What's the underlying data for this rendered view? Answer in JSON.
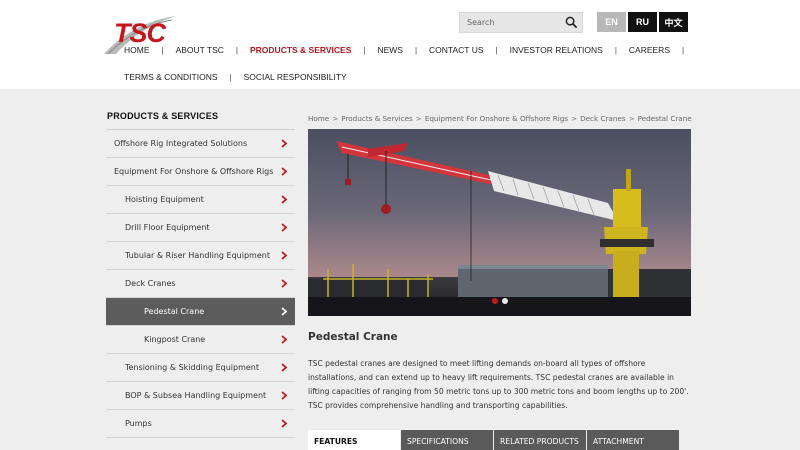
{
  "brand": {
    "logo_text": "TSC"
  },
  "search": {
    "placeholder": "Search"
  },
  "languages": [
    "EN",
    "RU",
    "中文"
  ],
  "nav": {
    "row1": [
      "HOME",
      "ABOUT TSC",
      "PRODUCTS & SERVICES",
      "NEWS",
      "CONTACT US",
      "INVESTOR RELATIONS",
      "CAREERS"
    ],
    "row2": [
      "TERMS & CONDITIONS",
      "SOCIAL RESPONSIBILITY"
    ]
  },
  "sidebar": {
    "title": "PRODUCTS & SERVICES",
    "items": [
      {
        "label": "Offshore Rig Integrated Solutions"
      },
      {
        "label": "Equipment For Onshore & Offshore Rigs"
      },
      {
        "label": "Hoisting Equipment"
      },
      {
        "label": "Drill Floor Equipment"
      },
      {
        "label": "Tubular & Riser Handling Equipment"
      },
      {
        "label": "Deck Cranes"
      },
      {
        "label": "Pedestal Crane"
      },
      {
        "label": "Kingpost Crane"
      },
      {
        "label": "Tensioning & Skidding Equipment"
      },
      {
        "label": "BOP & Subsea Handling Equipment"
      },
      {
        "label": "Pumps"
      }
    ]
  },
  "breadcrumb": [
    "Home",
    "Products & Services",
    "Equipment For Onshore & Offshore Rigs",
    "Deck Cranes",
    "Pedestal Crane"
  ],
  "breadcrumb_sep": ">",
  "main": {
    "title": "Pedestal Crane",
    "description": "TSC pedestal cranes are designed to meet lifting demands on-board all types of offshore installations, and can extend up to heavy lift requirements. TSC pedestal cranes are available in lifting capacities of ranging from 50 metric tons up to 300 metric tons and boom lengths up to 200'. TSC provides comprehensive handling and transporting capabilities.",
    "tabs": [
      "FEATURES",
      "SPECIFICATIONS",
      "RELATED PRODUCTS",
      "ATTACHMENT"
    ]
  },
  "colors": {
    "accent": "#b6171d",
    "sidebar_active": "#5c5c5c",
    "tab_bg": "#5a5a5a"
  }
}
